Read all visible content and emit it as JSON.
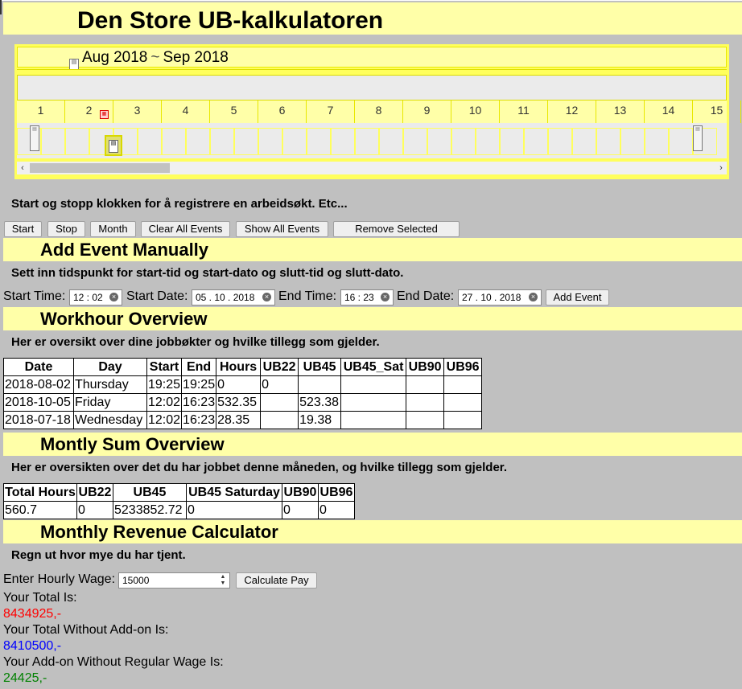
{
  "app_title": "Den Store UB-kalkulatoren",
  "timeline": {
    "range_start": "Aug 2018",
    "range_separator": "~",
    "range_end": "Sep 2018",
    "days": [
      "1",
      "2",
      "3",
      "4",
      "5",
      "6",
      "7",
      "8",
      "9",
      "10",
      "11",
      "12",
      "13",
      "14",
      "15"
    ]
  },
  "instructions": "Start og stopp klokken for å registrere en arbeidsøkt. Etc...",
  "toolbar": {
    "start": "Start",
    "stop": "Stop",
    "month": "Month",
    "clear_all": "Clear All Events",
    "show_all": "Show All Events",
    "remove_selected": "Remove Selected Event"
  },
  "add_event": {
    "heading": "Add Event Manually",
    "description": "Sett inn tidspunkt for start-tid og start-dato og slutt-tid og slutt-dato.",
    "start_time_label": "Start Time:",
    "start_time_value": "12 : 02",
    "start_date_label": "Start Date:",
    "start_date_value": "05 . 10 . 2018",
    "end_time_label": "End Time:",
    "end_time_value": "16 : 23",
    "end_date_label": "End Date:",
    "end_date_value": "27 . 10 . 2018",
    "button": "Add Event"
  },
  "workhour": {
    "heading": "Workhour Overview",
    "description": "Her er oversikt over dine jobbøkter og hvilke tillegg som gjelder.",
    "columns": [
      "Date",
      "Day",
      "Start",
      "End",
      "Hours",
      "UB22",
      "UB45",
      "UB45_Sat",
      "UB90",
      "UB96"
    ],
    "rows": [
      [
        "2018-08-02",
        "Thursday",
        "19:25",
        "19:25",
        "0",
        "0",
        "",
        "",
        "",
        ""
      ],
      [
        "2018-10-05",
        "Friday",
        "12:02",
        "16:23",
        "532.35",
        "",
        "523.38",
        "",
        "",
        ""
      ],
      [
        "2018-07-18",
        "Wednesday",
        "12:02",
        "16:23",
        "28.35",
        "",
        "19.38",
        "",
        "",
        ""
      ]
    ]
  },
  "monthly_sum": {
    "heading": "Montly Sum Overview",
    "description": "Her er oversikten over det du har jobbet denne måneden, og hvilke tillegg som gjelder.",
    "columns": [
      "Total Hours",
      "UB22",
      "UB45",
      "UB45 Saturday",
      "UB90",
      "UB96"
    ],
    "rows": [
      [
        "560.7",
        "0",
        "5233852.72",
        "0",
        "0",
        "0"
      ]
    ]
  },
  "revenue": {
    "heading": "Monthly Revenue Calculator",
    "description": "Regn ut hvor mye du har tjent.",
    "wage_label": "Enter Hourly Wage:",
    "wage_value": "15000",
    "button": "Calculate Pay",
    "total_label": "Your Total Is:",
    "total_value": "8434925,-",
    "total_color": "#ff0000",
    "without_addon_label": "Your Total Without Add-on Is:",
    "without_addon_value": "8410500,-",
    "without_addon_color": "#0000ff",
    "addon_label": "Your Add-on Without Regular Wage Is:",
    "addon_value": "24425,-",
    "addon_color": "#008000"
  }
}
